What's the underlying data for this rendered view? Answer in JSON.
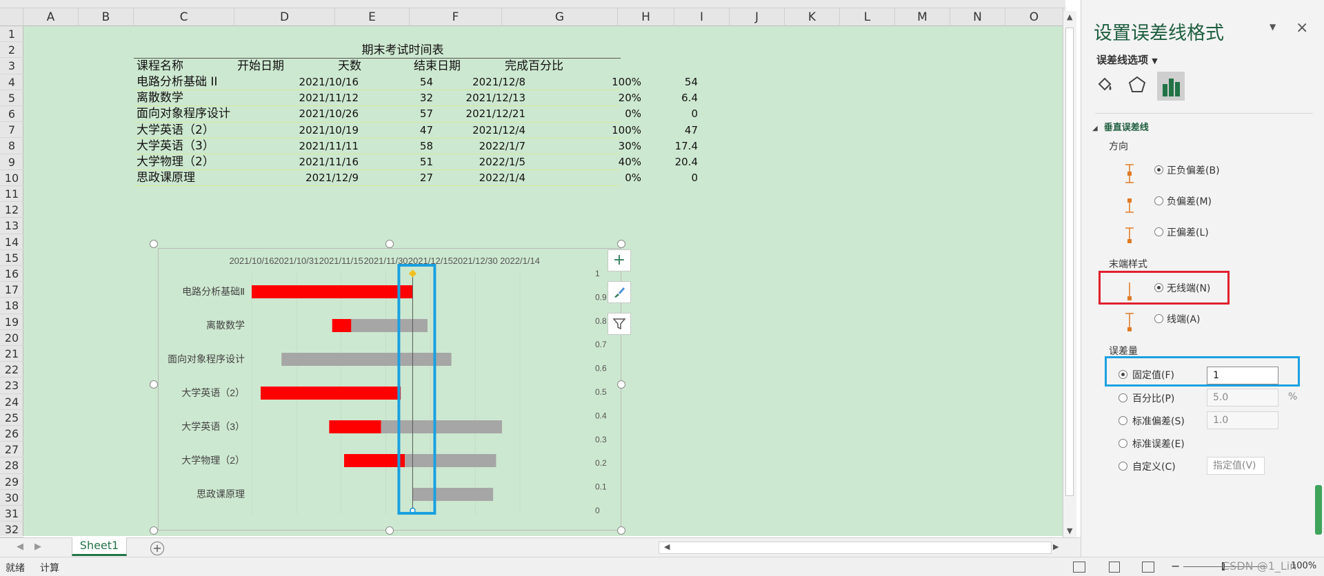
{
  "columns": [
    "A",
    "B",
    "C",
    "D",
    "E",
    "F",
    "G",
    "H",
    "I",
    "J",
    "K",
    "L",
    "M",
    "N",
    "O"
  ],
  "rows": [
    "1",
    "2",
    "3",
    "4",
    "5",
    "6",
    "7",
    "8",
    "9",
    "10",
    "11",
    "12",
    "13",
    "14",
    "15",
    "16",
    "17",
    "18",
    "19",
    "20",
    "21",
    "22",
    "23",
    "24",
    "25",
    "26",
    "27",
    "28",
    "29",
    "30",
    "31",
    "32"
  ],
  "table": {
    "title": "期末考试时间表",
    "headers": [
      "课程名称",
      "开始日期",
      "天数",
      "结束日期",
      "完成百分比"
    ],
    "rows": [
      {
        "name": "电路分析基础 II",
        "start": "2021/10/16",
        "days": "54",
        "end": "2021/12/8",
        "pct": "100%",
        "h": "54"
      },
      {
        "name": "离散数学",
        "start": "2021/11/12",
        "days": "32",
        "end": "2021/12/13",
        "pct": "20%",
        "h": "6.4"
      },
      {
        "name": "面向对象程序设计",
        "start": "2021/10/26",
        "days": "57",
        "end": "2021/12/21",
        "pct": "0%",
        "h": "0"
      },
      {
        "name": "大学英语（2）",
        "start": "2021/10/19",
        "days": "47",
        "end": "2021/12/4",
        "pct": "100%",
        "h": "47"
      },
      {
        "name": "大学英语（3）",
        "start": "2021/11/11",
        "days": "58",
        "end": "2022/1/7",
        "pct": "30%",
        "h": "17.4"
      },
      {
        "name": "大学物理（2）",
        "start": "2021/11/16",
        "days": "51",
        "end": "2022/1/5",
        "pct": "40%",
        "h": "20.4"
      },
      {
        "name": "思政课原理",
        "start": "2021/12/9",
        "days": "27",
        "end": "2022/1/4",
        "pct": "0%",
        "h": "0"
      }
    ]
  },
  "chart_data": {
    "type": "bar",
    "orientation": "horizontal-stacked-gantt",
    "x_ticks": [
      "2021/10/16",
      "2021/10/31",
      "2021/11/15",
      "2021/11/30",
      "2021/12/15",
      "2021/12/30",
      "2022/1/14"
    ],
    "y2_ticks": [
      "1",
      "0.9",
      "0.8",
      "0.7",
      "0.6",
      "0.5",
      "0.4",
      "0.3",
      "0.2",
      "0.1",
      "0"
    ],
    "categories": [
      "电路分析基础Ⅱ",
      "离散数学",
      "面向对象程序设计",
      "大学英语（2）",
      "大学英语（3）",
      "大学物理（2）",
      "思政课原理"
    ],
    "start": [
      "2021/10/16",
      "2021/11/12",
      "2021/10/26",
      "2021/10/19",
      "2021/11/11",
      "2021/11/16",
      "2021/12/9"
    ],
    "days": [
      54,
      32,
      57,
      47,
      58,
      51,
      27
    ],
    "completed_days": [
      54,
      6.4,
      0,
      47,
      17.4,
      20.4,
      0
    ],
    "series": [
      {
        "name": "",
        "color": "#ff0000",
        "role": "completed"
      },
      {
        "name": "",
        "color": "#a6a6a6",
        "role": "remaining"
      }
    ],
    "vertical_line": {
      "y_from": 0,
      "y_to": 1,
      "error_amount": 1
    }
  },
  "chart_buttons": {
    "add": "+",
    "style": "brush-icon",
    "filter": "filter-icon"
  },
  "pane": {
    "title": "设置误差线格式",
    "options_label": "误差线选项",
    "section": "垂直误差线",
    "direction_label": "方向",
    "direction": [
      "正负偏差(B)",
      "负偏差(M)",
      "正偏差(L)"
    ],
    "end_style_label": "末端样式",
    "end_style": [
      "无线端(N)",
      "线端(A)"
    ],
    "amount_label": "误差量",
    "fixed": "固定值(F)",
    "fixed_value": "1",
    "percent": "百分比(P)",
    "percent_value": "5.0",
    "percent_unit": "%",
    "stddev": "标准偏差(S)",
    "stddev_value": "1.0",
    "stderr": "标准误差(E)",
    "custom": "自定义(C)",
    "custom_button": "指定值(V)"
  },
  "sheet_tab": "Sheet1",
  "status": {
    "ready": "就绪",
    "calc": "计算",
    "zoom": "100%",
    "watermark": "CSDN @1_Lin"
  },
  "colors": {
    "grid_bg": "#cde8d0",
    "red_box": "#e02030",
    "blue_box": "#1aa0e0",
    "accent": "#217346"
  }
}
